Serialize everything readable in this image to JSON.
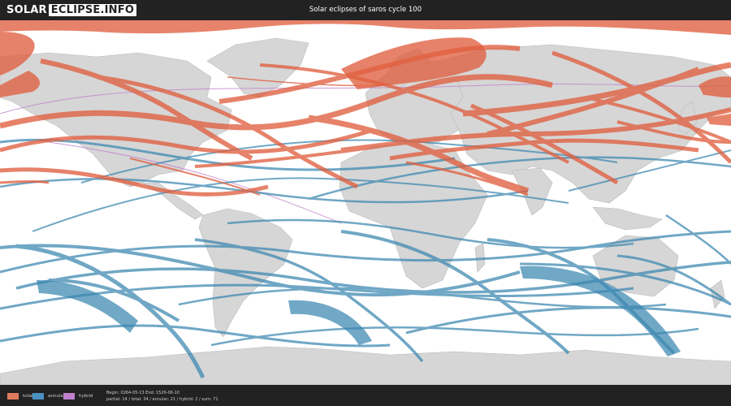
{
  "header": {
    "logo_part1": "SOLAR",
    "logo_part2": "ECLIPSE.INFO",
    "title": "Solar eclipses of saros cycle 100"
  },
  "colors": {
    "total": "#e06040",
    "annular": "#3a86b0",
    "hybrid": "#c080cc",
    "land": "#d6d6d6",
    "ocean": "#ffffff",
    "bar": "#222222"
  },
  "legend": [
    {
      "label": "total",
      "color": "#e07a5f"
    },
    {
      "label": "annular",
      "color": "#4a90c0"
    },
    {
      "label": "hybrid",
      "color": "#c080cc"
    }
  ],
  "stats": {
    "line1": "Begin: 0264-05-13 End: 1526-06-10",
    "line2": "partial: 14 / total: 34 / annular: 21 / hybrid: 2 / sum: 71"
  }
}
